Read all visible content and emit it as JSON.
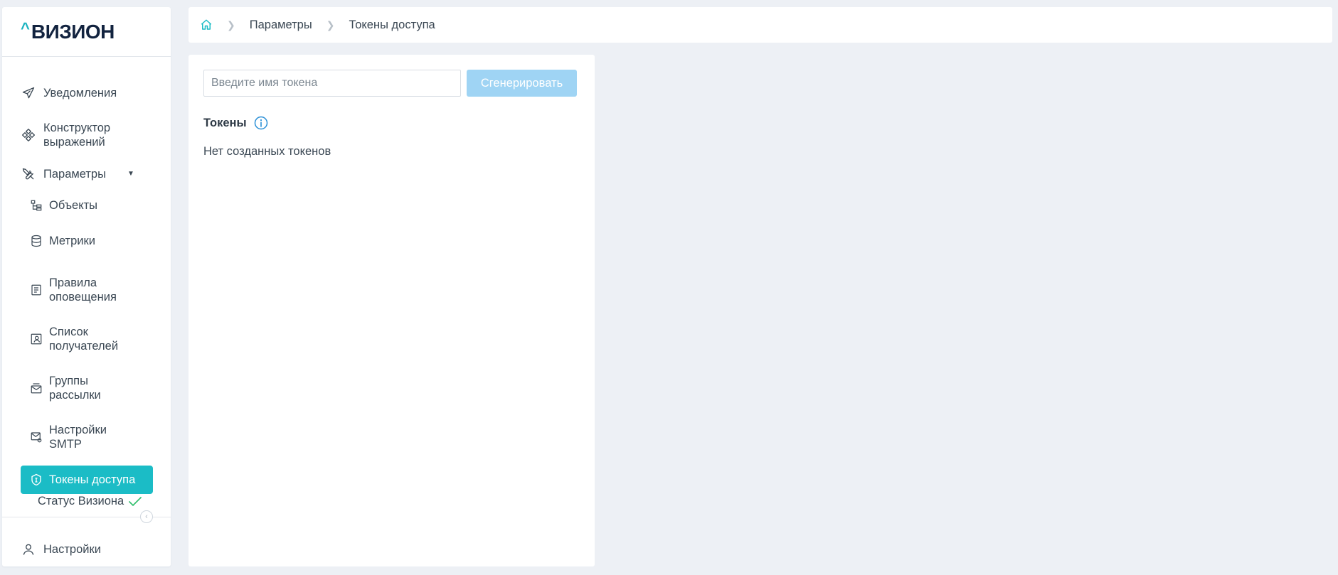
{
  "logo": {
    "caret": "^",
    "text": "ВИЗИОН"
  },
  "sidebar": {
    "items": [
      {
        "label": "Уведомления",
        "icon": "send-icon"
      },
      {
        "label": "Конструктор выражений",
        "icon": "diamond-grid-icon"
      },
      {
        "label": "Параметры",
        "icon": "tools-icon",
        "expanded": true
      },
      {
        "label": "Объекты",
        "icon": "hierarchy-icon"
      },
      {
        "label": "Метрики",
        "icon": "database-icon"
      },
      {
        "label": "Правила оповещения",
        "icon": "document-icon"
      },
      {
        "label": "Список получателей",
        "icon": "user-card-icon"
      },
      {
        "label": "Группы рассылки",
        "icon": "mail-group-icon"
      },
      {
        "label": "Настройки SMTP",
        "icon": "mail-settings-icon"
      },
      {
        "label": "Токены доступа",
        "icon": "token-shield-icon",
        "active": true
      }
    ],
    "status": {
      "label": "Статус Визиона",
      "ok": true
    },
    "settings": {
      "label": "Настройки",
      "icon": "user-icon"
    }
  },
  "breadcrumb": {
    "home_icon": "home-icon",
    "items": [
      "Параметры",
      "Токены доступа"
    ]
  },
  "token_form": {
    "input_placeholder": "Введите имя токена",
    "input_value": "",
    "generate_label": "Сгенерировать",
    "generate_disabled": true
  },
  "tokens": {
    "title": "Токены",
    "empty_message": "Нет созданных токенов"
  },
  "colors": {
    "accent": "#1bbcc6",
    "button_disabled": "#9fd4f4",
    "background": "#edf0f5",
    "info": "#2a8fd6",
    "ok": "#38c172"
  }
}
